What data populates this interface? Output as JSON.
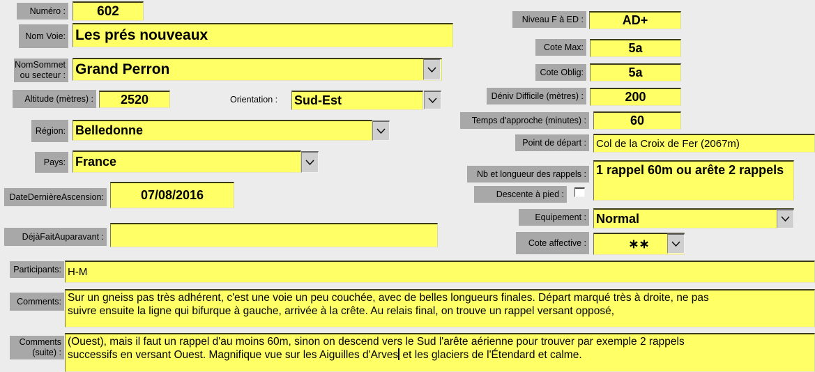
{
  "form": {
    "left": {
      "numero": {
        "label": "Numéro :",
        "value": "602"
      },
      "nom_voie": {
        "label": "Nom Voie:",
        "value": "Les prés nouveaux"
      },
      "nom_sommet": {
        "label": "NomSommet\nou secteur :",
        "value": "Grand Perron"
      },
      "altitude": {
        "label": "Altitude (mètres) :",
        "value": "2520"
      },
      "orientation": {
        "label": "Orientation :",
        "value": "Sud-Est"
      },
      "region": {
        "label": "Région:",
        "value": "Belledonne"
      },
      "pays": {
        "label": "Pays:",
        "value": "France"
      },
      "date_derniere_ascension": {
        "label": "DateDernièreAscension:",
        "value": "07/08/2016"
      },
      "deja_fait_auparavant": {
        "label": "DéjàFaitAuparavant :",
        "value": ""
      }
    },
    "right": {
      "niveau": {
        "label": "Niveau F à ED :",
        "value": "AD+"
      },
      "cote_max": {
        "label": "Cote Max:",
        "value": "5a"
      },
      "cote_oblig": {
        "label": "Cote Oblig:",
        "value": "5a"
      },
      "deniv_difficile": {
        "label": "Déniv Difficile (mètres) :",
        "value": "200"
      },
      "temps_approche": {
        "label": "Temps d'approche (minutes) :",
        "value": "60"
      },
      "point_depart": {
        "label": "Point de départ :",
        "value": "Col de la Croix de Fer (2067m)"
      },
      "rappels": {
        "label": "Nb et longueur des rappels :",
        "value": "1 rappel 60m ou arête 2 rappels"
      },
      "descente_a_pied": {
        "label": "Descente à pied :",
        "checked": false
      },
      "equipement": {
        "label": "Equipement :",
        "value": "Normal"
      },
      "cote_affective": {
        "label": "Cote affective :",
        "value": "∗∗"
      }
    },
    "bottom": {
      "participants": {
        "label": "Participants:",
        "value": "H-M"
      },
      "comments": {
        "label": "Comments:",
        "line1": "Sur un gneiss pas très adhérent, c'est une voie un peu couchée, avec de belles longueurs finales. Départ marqué très à droite, ne pas",
        "line2": "suivre ensuite la ligne qui bifurque à gauche, arrivée à la crête. Au relais final, on trouve un rappel versant opposé,"
      },
      "comments_suite": {
        "label": "Comments\n(suite) :",
        "line1": "(Ouest), mais il faut un rappel d'au moins 60m, sinon on descend vers le Sud l'arête aérienne pour trouver par exemple 2 rappels",
        "line2a": "successifs en versant Ouest. Magnifique vue sur les Aiguilles d'Arves",
        "line2b": " et les glaciers de l'Étendard et calme."
      }
    }
  }
}
